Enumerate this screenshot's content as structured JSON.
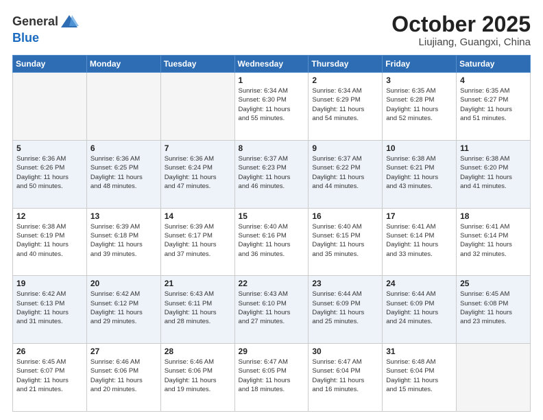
{
  "header": {
    "logo_line1": "General",
    "logo_line2": "Blue",
    "month": "October 2025",
    "location": "Liujiang, Guangxi, China"
  },
  "weekdays": [
    "Sunday",
    "Monday",
    "Tuesday",
    "Wednesday",
    "Thursday",
    "Friday",
    "Saturday"
  ],
  "weeks": [
    [
      {
        "day": "",
        "info": ""
      },
      {
        "day": "",
        "info": ""
      },
      {
        "day": "",
        "info": ""
      },
      {
        "day": "1",
        "info": "Sunrise: 6:34 AM\nSunset: 6:30 PM\nDaylight: 11 hours\nand 55 minutes."
      },
      {
        "day": "2",
        "info": "Sunrise: 6:34 AM\nSunset: 6:29 PM\nDaylight: 11 hours\nand 54 minutes."
      },
      {
        "day": "3",
        "info": "Sunrise: 6:35 AM\nSunset: 6:28 PM\nDaylight: 11 hours\nand 52 minutes."
      },
      {
        "day": "4",
        "info": "Sunrise: 6:35 AM\nSunset: 6:27 PM\nDaylight: 11 hours\nand 51 minutes."
      }
    ],
    [
      {
        "day": "5",
        "info": "Sunrise: 6:36 AM\nSunset: 6:26 PM\nDaylight: 11 hours\nand 50 minutes."
      },
      {
        "day": "6",
        "info": "Sunrise: 6:36 AM\nSunset: 6:25 PM\nDaylight: 11 hours\nand 48 minutes."
      },
      {
        "day": "7",
        "info": "Sunrise: 6:36 AM\nSunset: 6:24 PM\nDaylight: 11 hours\nand 47 minutes."
      },
      {
        "day": "8",
        "info": "Sunrise: 6:37 AM\nSunset: 6:23 PM\nDaylight: 11 hours\nand 46 minutes."
      },
      {
        "day": "9",
        "info": "Sunrise: 6:37 AM\nSunset: 6:22 PM\nDaylight: 11 hours\nand 44 minutes."
      },
      {
        "day": "10",
        "info": "Sunrise: 6:38 AM\nSunset: 6:21 PM\nDaylight: 11 hours\nand 43 minutes."
      },
      {
        "day": "11",
        "info": "Sunrise: 6:38 AM\nSunset: 6:20 PM\nDaylight: 11 hours\nand 41 minutes."
      }
    ],
    [
      {
        "day": "12",
        "info": "Sunrise: 6:38 AM\nSunset: 6:19 PM\nDaylight: 11 hours\nand 40 minutes."
      },
      {
        "day": "13",
        "info": "Sunrise: 6:39 AM\nSunset: 6:18 PM\nDaylight: 11 hours\nand 39 minutes."
      },
      {
        "day": "14",
        "info": "Sunrise: 6:39 AM\nSunset: 6:17 PM\nDaylight: 11 hours\nand 37 minutes."
      },
      {
        "day": "15",
        "info": "Sunrise: 6:40 AM\nSunset: 6:16 PM\nDaylight: 11 hours\nand 36 minutes."
      },
      {
        "day": "16",
        "info": "Sunrise: 6:40 AM\nSunset: 6:15 PM\nDaylight: 11 hours\nand 35 minutes."
      },
      {
        "day": "17",
        "info": "Sunrise: 6:41 AM\nSunset: 6:14 PM\nDaylight: 11 hours\nand 33 minutes."
      },
      {
        "day": "18",
        "info": "Sunrise: 6:41 AM\nSunset: 6:14 PM\nDaylight: 11 hours\nand 32 minutes."
      }
    ],
    [
      {
        "day": "19",
        "info": "Sunrise: 6:42 AM\nSunset: 6:13 PM\nDaylight: 11 hours\nand 31 minutes."
      },
      {
        "day": "20",
        "info": "Sunrise: 6:42 AM\nSunset: 6:12 PM\nDaylight: 11 hours\nand 29 minutes."
      },
      {
        "day": "21",
        "info": "Sunrise: 6:43 AM\nSunset: 6:11 PM\nDaylight: 11 hours\nand 28 minutes."
      },
      {
        "day": "22",
        "info": "Sunrise: 6:43 AM\nSunset: 6:10 PM\nDaylight: 11 hours\nand 27 minutes."
      },
      {
        "day": "23",
        "info": "Sunrise: 6:44 AM\nSunset: 6:09 PM\nDaylight: 11 hours\nand 25 minutes."
      },
      {
        "day": "24",
        "info": "Sunrise: 6:44 AM\nSunset: 6:09 PM\nDaylight: 11 hours\nand 24 minutes."
      },
      {
        "day": "25",
        "info": "Sunrise: 6:45 AM\nSunset: 6:08 PM\nDaylight: 11 hours\nand 23 minutes."
      }
    ],
    [
      {
        "day": "26",
        "info": "Sunrise: 6:45 AM\nSunset: 6:07 PM\nDaylight: 11 hours\nand 21 minutes."
      },
      {
        "day": "27",
        "info": "Sunrise: 6:46 AM\nSunset: 6:06 PM\nDaylight: 11 hours\nand 20 minutes."
      },
      {
        "day": "28",
        "info": "Sunrise: 6:46 AM\nSunset: 6:06 PM\nDaylight: 11 hours\nand 19 minutes."
      },
      {
        "day": "29",
        "info": "Sunrise: 6:47 AM\nSunset: 6:05 PM\nDaylight: 11 hours\nand 18 minutes."
      },
      {
        "day": "30",
        "info": "Sunrise: 6:47 AM\nSunset: 6:04 PM\nDaylight: 11 hours\nand 16 minutes."
      },
      {
        "day": "31",
        "info": "Sunrise: 6:48 AM\nSunset: 6:04 PM\nDaylight: 11 hours\nand 15 minutes."
      },
      {
        "day": "",
        "info": ""
      }
    ]
  ]
}
